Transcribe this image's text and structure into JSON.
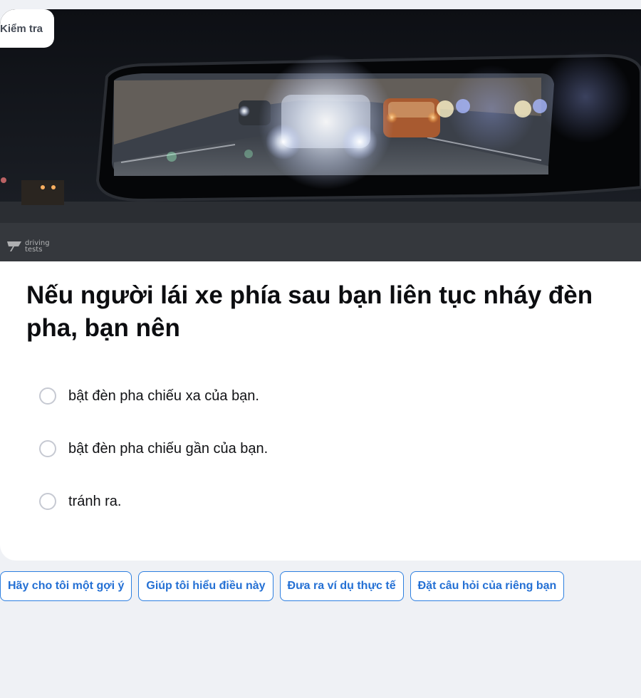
{
  "badge": {
    "label": "Kiểm tra"
  },
  "image": {
    "watermark_line1": "driving",
    "watermark_line2": "tests"
  },
  "question": {
    "text": "Nếu người lái xe phía sau bạn liên tục nháy đèn pha, bạn nên",
    "options": [
      {
        "label": "bật đèn pha chiếu xa của bạn."
      },
      {
        "label": "bật đèn pha chiếu gần của bạn."
      },
      {
        "label": "tránh ra."
      }
    ]
  },
  "chips": [
    {
      "label": "Hãy cho tôi một gợi ý"
    },
    {
      "label": "Giúp tôi hiểu điều này"
    },
    {
      "label": "Đưa ra ví dụ thực tế"
    },
    {
      "label": "Đặt câu hỏi của riêng bạn"
    }
  ],
  "colors": {
    "accent": "#2d7fe0",
    "page_background": "#eff1f5",
    "card_background": "#ffffff",
    "radio_border": "#c6c9d2"
  }
}
